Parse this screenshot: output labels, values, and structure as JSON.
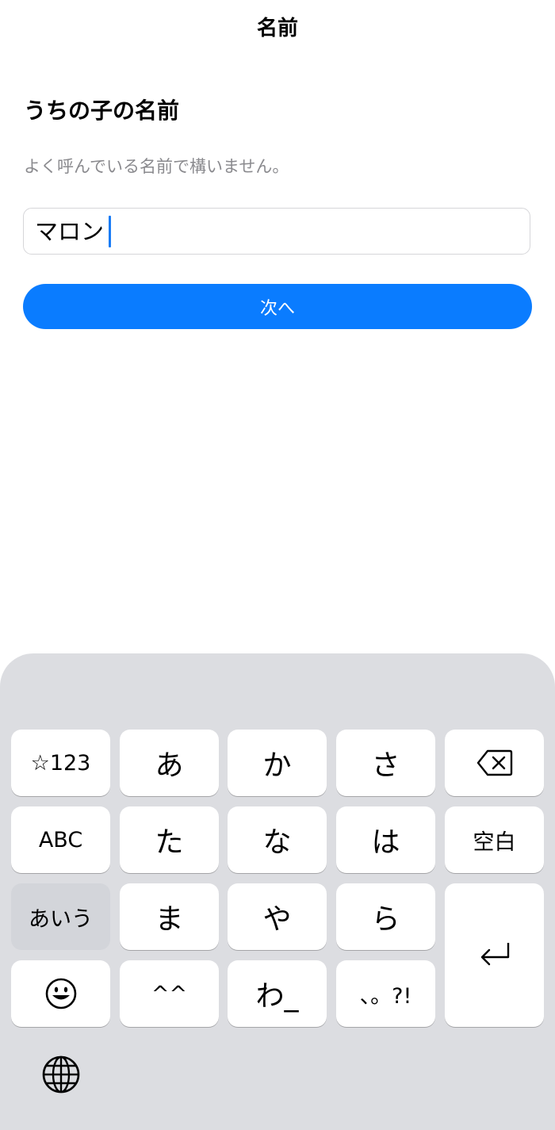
{
  "nav": {
    "title": "名前"
  },
  "form": {
    "heading": "うちの子の名前",
    "description": "よく呼んでいる名前で構いません。",
    "name_value": "マロン",
    "next_label": "次へ",
    "accent_color": "#0a7cff"
  },
  "keyboard": {
    "row1": {
      "symbols": "☆123",
      "k1": "あ",
      "k2": "か",
      "k3": "さ",
      "delete_icon": "delete-backward-icon"
    },
    "row2": {
      "abc": "ABC",
      "k1": "た",
      "k2": "な",
      "k3": "は",
      "space": "空白"
    },
    "row3": {
      "kana": "あいう",
      "k1": "ま",
      "k2": "や",
      "k3": "ら",
      "return_icon": "return-icon"
    },
    "row4": {
      "emoji_icon": "emoji-icon",
      "k1": "^^",
      "k2": "わ_",
      "k3": "、。?!"
    },
    "globe_icon": "globe-icon"
  }
}
